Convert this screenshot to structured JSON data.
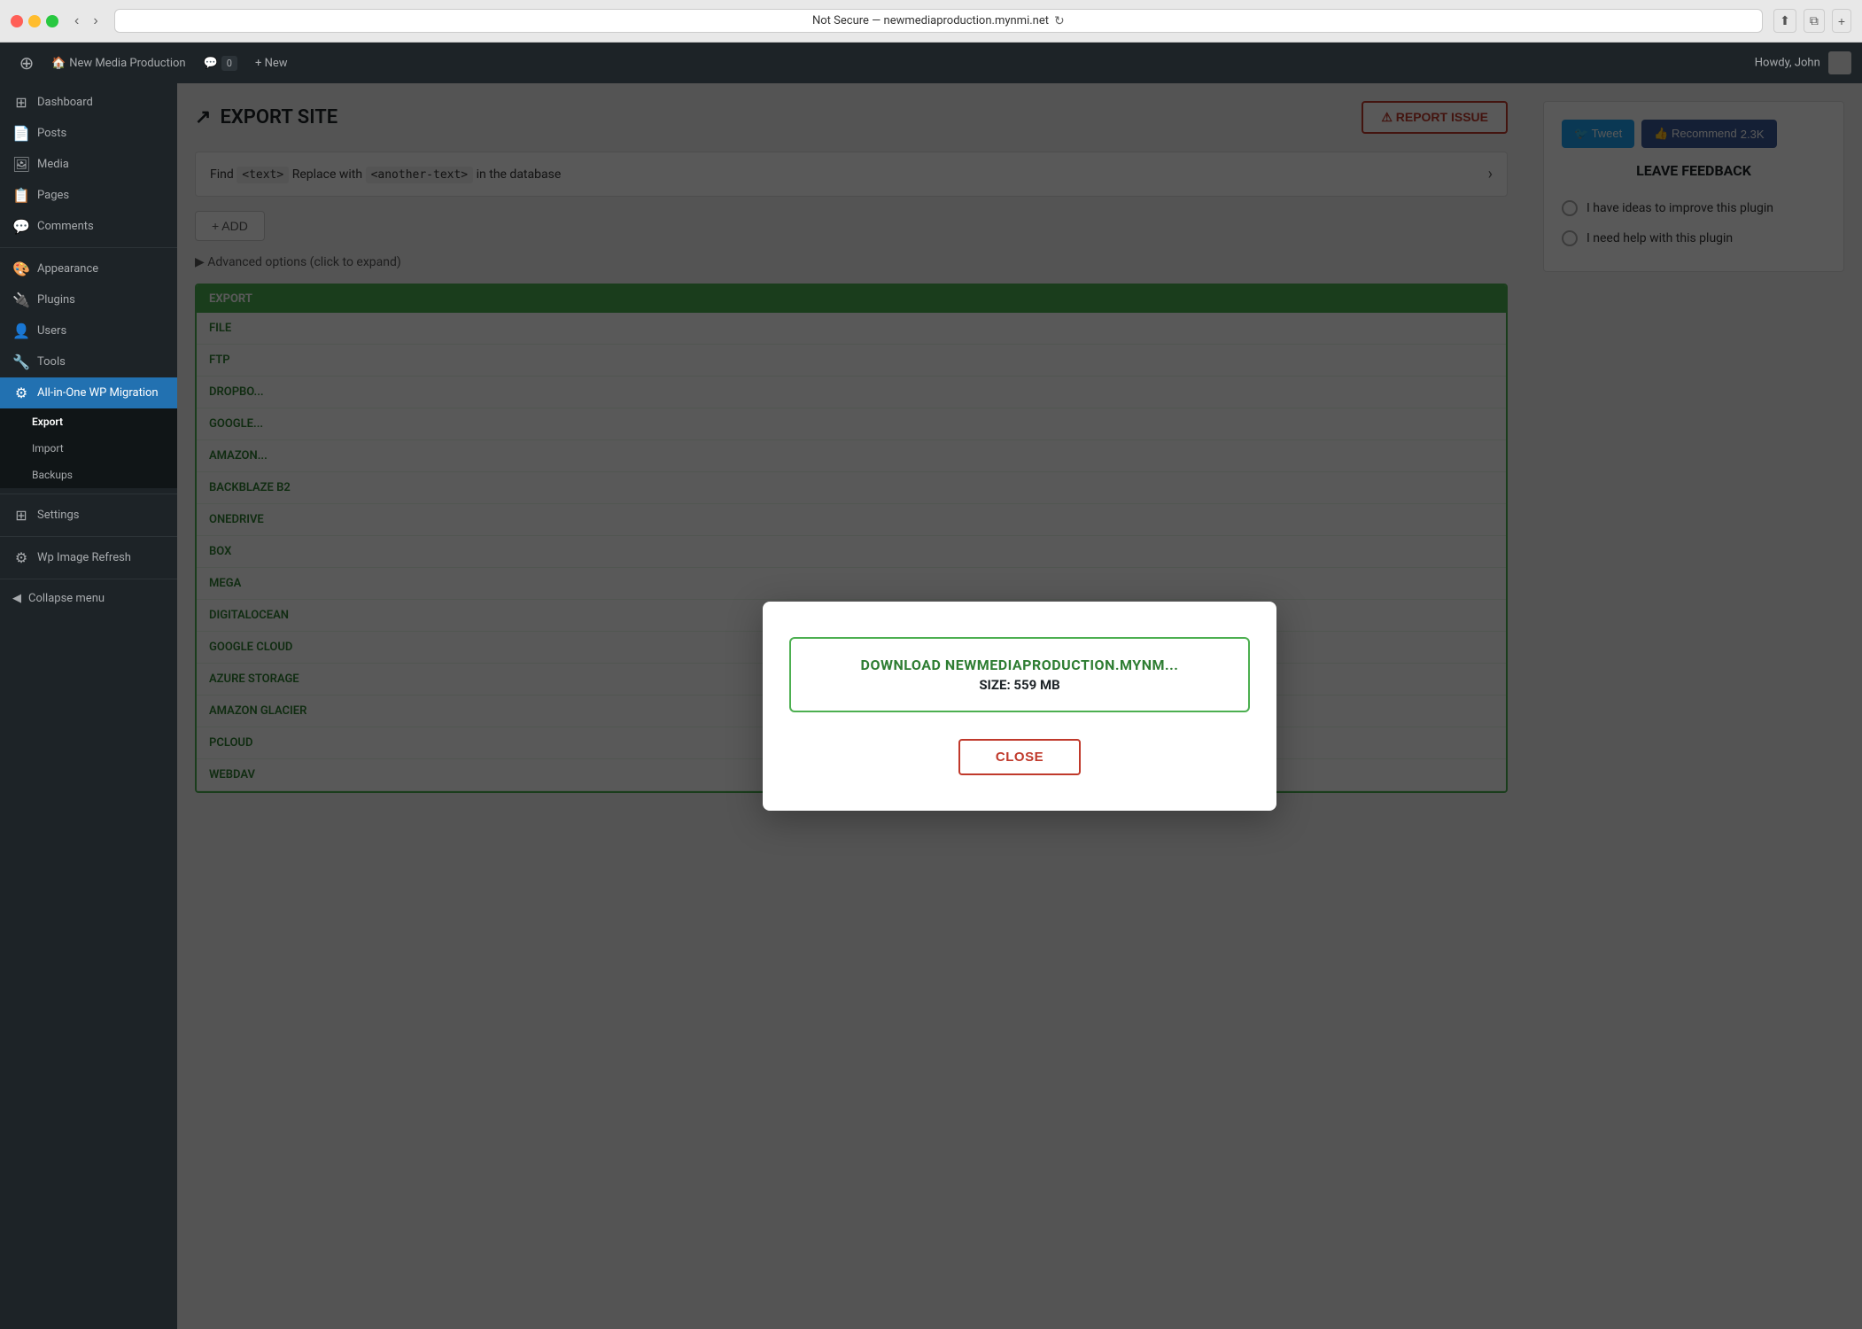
{
  "browser": {
    "url": "Not Secure — newmediaproduction.mynmi.net",
    "back_label": "‹",
    "forward_label": "›",
    "reload_label": "↻",
    "share_label": "⬆",
    "tab_label": "⧉",
    "new_tab_label": "+"
  },
  "admin_bar": {
    "site_name": "New Media Production",
    "comments_count": "0",
    "new_label": "+ New",
    "howdy": "Howdy, John"
  },
  "sidebar": {
    "items": [
      {
        "id": "dashboard",
        "label": "Dashboard",
        "icon": "⊞"
      },
      {
        "id": "posts",
        "label": "Posts",
        "icon": "📄"
      },
      {
        "id": "media",
        "label": "Media",
        "icon": "🖼"
      },
      {
        "id": "pages",
        "label": "Pages",
        "icon": "📋"
      },
      {
        "id": "comments",
        "label": "Comments",
        "icon": "💬"
      },
      {
        "id": "appearance",
        "label": "Appearance",
        "icon": "🎨"
      },
      {
        "id": "plugins",
        "label": "Plugins",
        "icon": "🔌"
      },
      {
        "id": "users",
        "label": "Users",
        "icon": "👤"
      },
      {
        "id": "tools",
        "label": "Tools",
        "icon": "🔧"
      },
      {
        "id": "allinone",
        "label": "All-in-One WP Migration",
        "icon": "⚙"
      }
    ],
    "submenu": {
      "export_label": "Export",
      "import_label": "Import",
      "backups_label": "Backups",
      "settings_label": "Settings"
    },
    "extra": [
      {
        "id": "wp-image-refresh",
        "label": "Wp Image Refresh",
        "icon": "⚙"
      }
    ],
    "collapse_label": "Collapse menu"
  },
  "main": {
    "export_title": "EXPORT SITE",
    "export_icon": "↗",
    "report_issue_label": "⚠ REPORT ISSUE",
    "find_replace_text": "Find ",
    "find_placeholder": "<text>",
    "replace_text": " Replace with ",
    "replace_placeholder": "<another-text>",
    "in_db_text": " in the database",
    "add_label": "+ ADD",
    "advanced_options_label": "▶ Advanced options",
    "advanced_options_note": "(click to expand)",
    "export_header": "EXPORT",
    "export_items": [
      "FILE",
      "FTP",
      "DROPBO...",
      "GOOGLE...",
      "AMAZON...",
      "BACKBLAZE B2",
      "ONEDRIVE",
      "BOX",
      "MEGA",
      "DIGITALOCEAN",
      "GOOGLE CLOUD",
      "AZURE STORAGE",
      "AMAZON GLACIER",
      "PCLOUD",
      "WEBDAV"
    ]
  },
  "feedback": {
    "tweet_label": "🐦 Tweet",
    "recommend_label": "👍 Recommend",
    "recommend_count": "2.3K",
    "title": "LEAVE FEEDBACK",
    "option1": "I have ideas to improve this plugin",
    "option2": "I need help with this plugin"
  },
  "modal": {
    "download_line1": "DOWNLOAD NEWMEDIAPRODUCTION.MYNM...",
    "download_line2": "SIZE: 559 MB",
    "close_label": "CLOSE"
  }
}
